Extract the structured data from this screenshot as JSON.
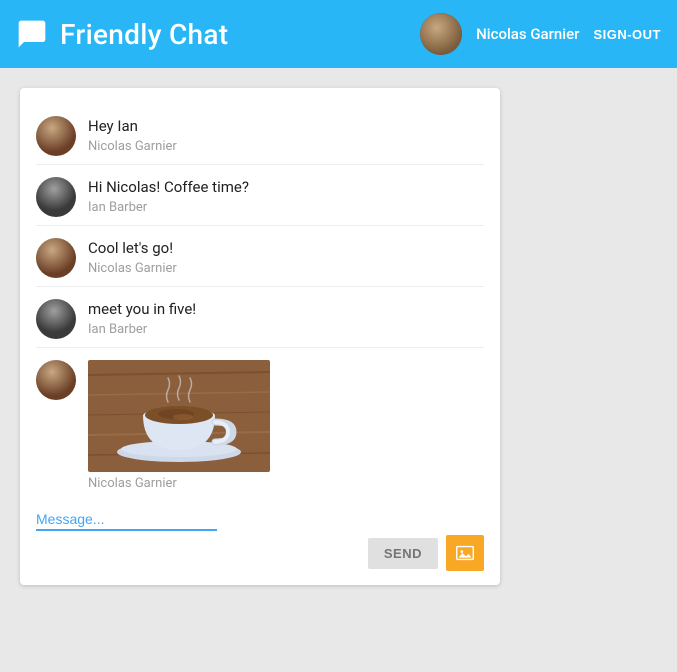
{
  "header": {
    "app_title": "Friendly Chat",
    "user_name": "Nicolas Garnier",
    "sign_out_label": "SIGN-OUT"
  },
  "messages": [
    {
      "id": 1,
      "text": "Hey Ian",
      "sender": "Nicolas Garnier",
      "avatar_type": "nicolas",
      "has_image": false
    },
    {
      "id": 2,
      "text": "Hi Nicolas! Coffee time?",
      "sender": "Ian Barber",
      "avatar_type": "ian",
      "has_image": false
    },
    {
      "id": 3,
      "text": "Cool let's go!",
      "sender": "Nicolas Garnier",
      "avatar_type": "nicolas",
      "has_image": false
    },
    {
      "id": 4,
      "text": "meet you in five!",
      "sender": "Ian Barber",
      "avatar_type": "ian",
      "has_image": false
    },
    {
      "id": 5,
      "text": "",
      "sender": "Nicolas Garnier",
      "avatar_type": "nicolas",
      "has_image": true
    }
  ],
  "input": {
    "placeholder": "Message...",
    "send_label": "SEND"
  },
  "colors": {
    "header_bg": "#29b6f6",
    "accent": "#42a5f5",
    "image_btn": "#f9a825"
  }
}
